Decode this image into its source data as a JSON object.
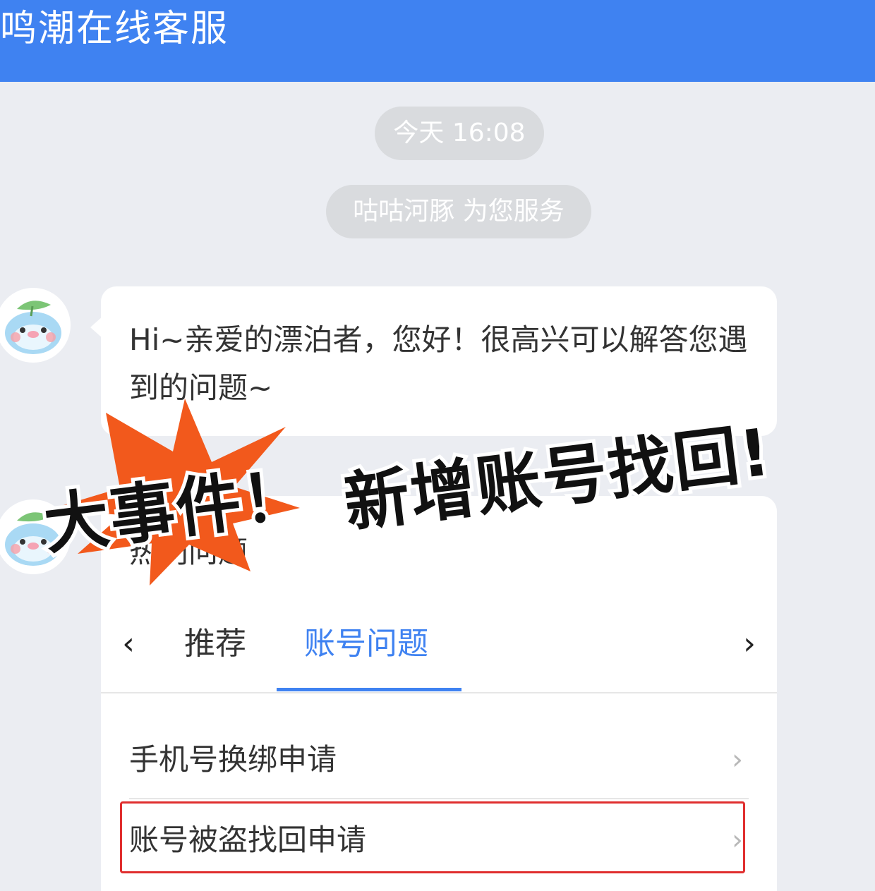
{
  "header": {
    "title": "鸣潮在线客服"
  },
  "chat": {
    "timestamp": "今天 16:08",
    "agent_notice": "咕咕河豚 为您服务",
    "greeting": "Hi~亲爱的漂泊者，您好！很高兴可以解答您遇到的问题~"
  },
  "faq": {
    "title": "热门问题",
    "tabs": [
      "推荐",
      "账号问题"
    ],
    "active_tab": "账号问题",
    "items": [
      {
        "label": "手机号换绑申请"
      },
      {
        "label": "账号被盗找回申请"
      }
    ]
  },
  "overlay": {
    "banner_left": "大事件！",
    "banner_right": "新增账号找回!"
  },
  "colors": {
    "header_bg": "#3f82f1",
    "accent": "#3f82f1",
    "burst": "#f2591c",
    "highlight": "#e02e2e"
  }
}
